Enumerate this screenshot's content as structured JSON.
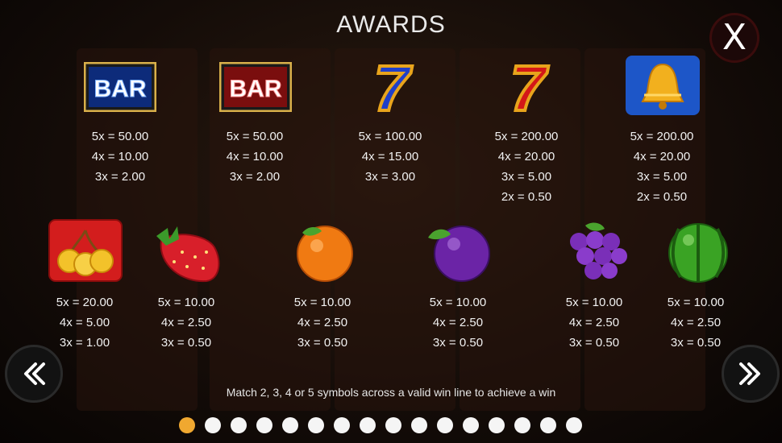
{
  "title": "AWARDS",
  "close_label": "X",
  "instructions": "Match 2, 3, 4 or 5 symbols across a valid win line to achieve a win",
  "symbols_row1": [
    {
      "name": "bar-blue",
      "label": "BAR",
      "payouts": [
        "5x = 50.00",
        "4x = 10.00",
        "3x = 2.00"
      ]
    },
    {
      "name": "bar-red",
      "label": "BAR",
      "payouts": [
        "5x = 50.00",
        "4x = 10.00",
        "3x = 2.00"
      ]
    },
    {
      "name": "seven-blue",
      "label": "7",
      "payouts": [
        "5x = 100.00",
        "4x = 15.00",
        "3x = 3.00"
      ]
    },
    {
      "name": "seven-red",
      "label": "7",
      "payouts": [
        "5x = 200.00",
        "4x = 20.00",
        "3x = 5.00",
        "2x = 0.50"
      ]
    },
    {
      "name": "bell",
      "payouts": [
        "5x = 200.00",
        "4x = 20.00",
        "3x = 5.00",
        "2x = 0.50"
      ]
    }
  ],
  "symbols_row2": [
    {
      "name": "cherries",
      "payouts": [
        "5x = 20.00",
        "4x = 5.00",
        "3x = 1.00"
      ]
    },
    {
      "name": "strawberry",
      "payouts": [
        "5x = 10.00",
        "4x = 2.50",
        "3x = 0.50"
      ]
    },
    {
      "name": "orange",
      "payouts": [
        "5x = 10.00",
        "4x = 2.50",
        "3x = 0.50"
      ]
    },
    {
      "name": "plum",
      "payouts": [
        "5x = 10.00",
        "4x = 2.50",
        "3x = 0.50"
      ]
    },
    {
      "name": "grapes",
      "payouts": [
        "5x = 10.00",
        "4x = 2.50",
        "3x = 0.50"
      ]
    },
    {
      "name": "watermelon",
      "payouts": [
        "5x = 10.00",
        "4x = 2.50",
        "3x = 0.50"
      ]
    }
  ],
  "pagination": {
    "total": 16,
    "current": 1
  },
  "colors": {
    "accent": "#f0a830",
    "dot": "#f5f5f5"
  }
}
